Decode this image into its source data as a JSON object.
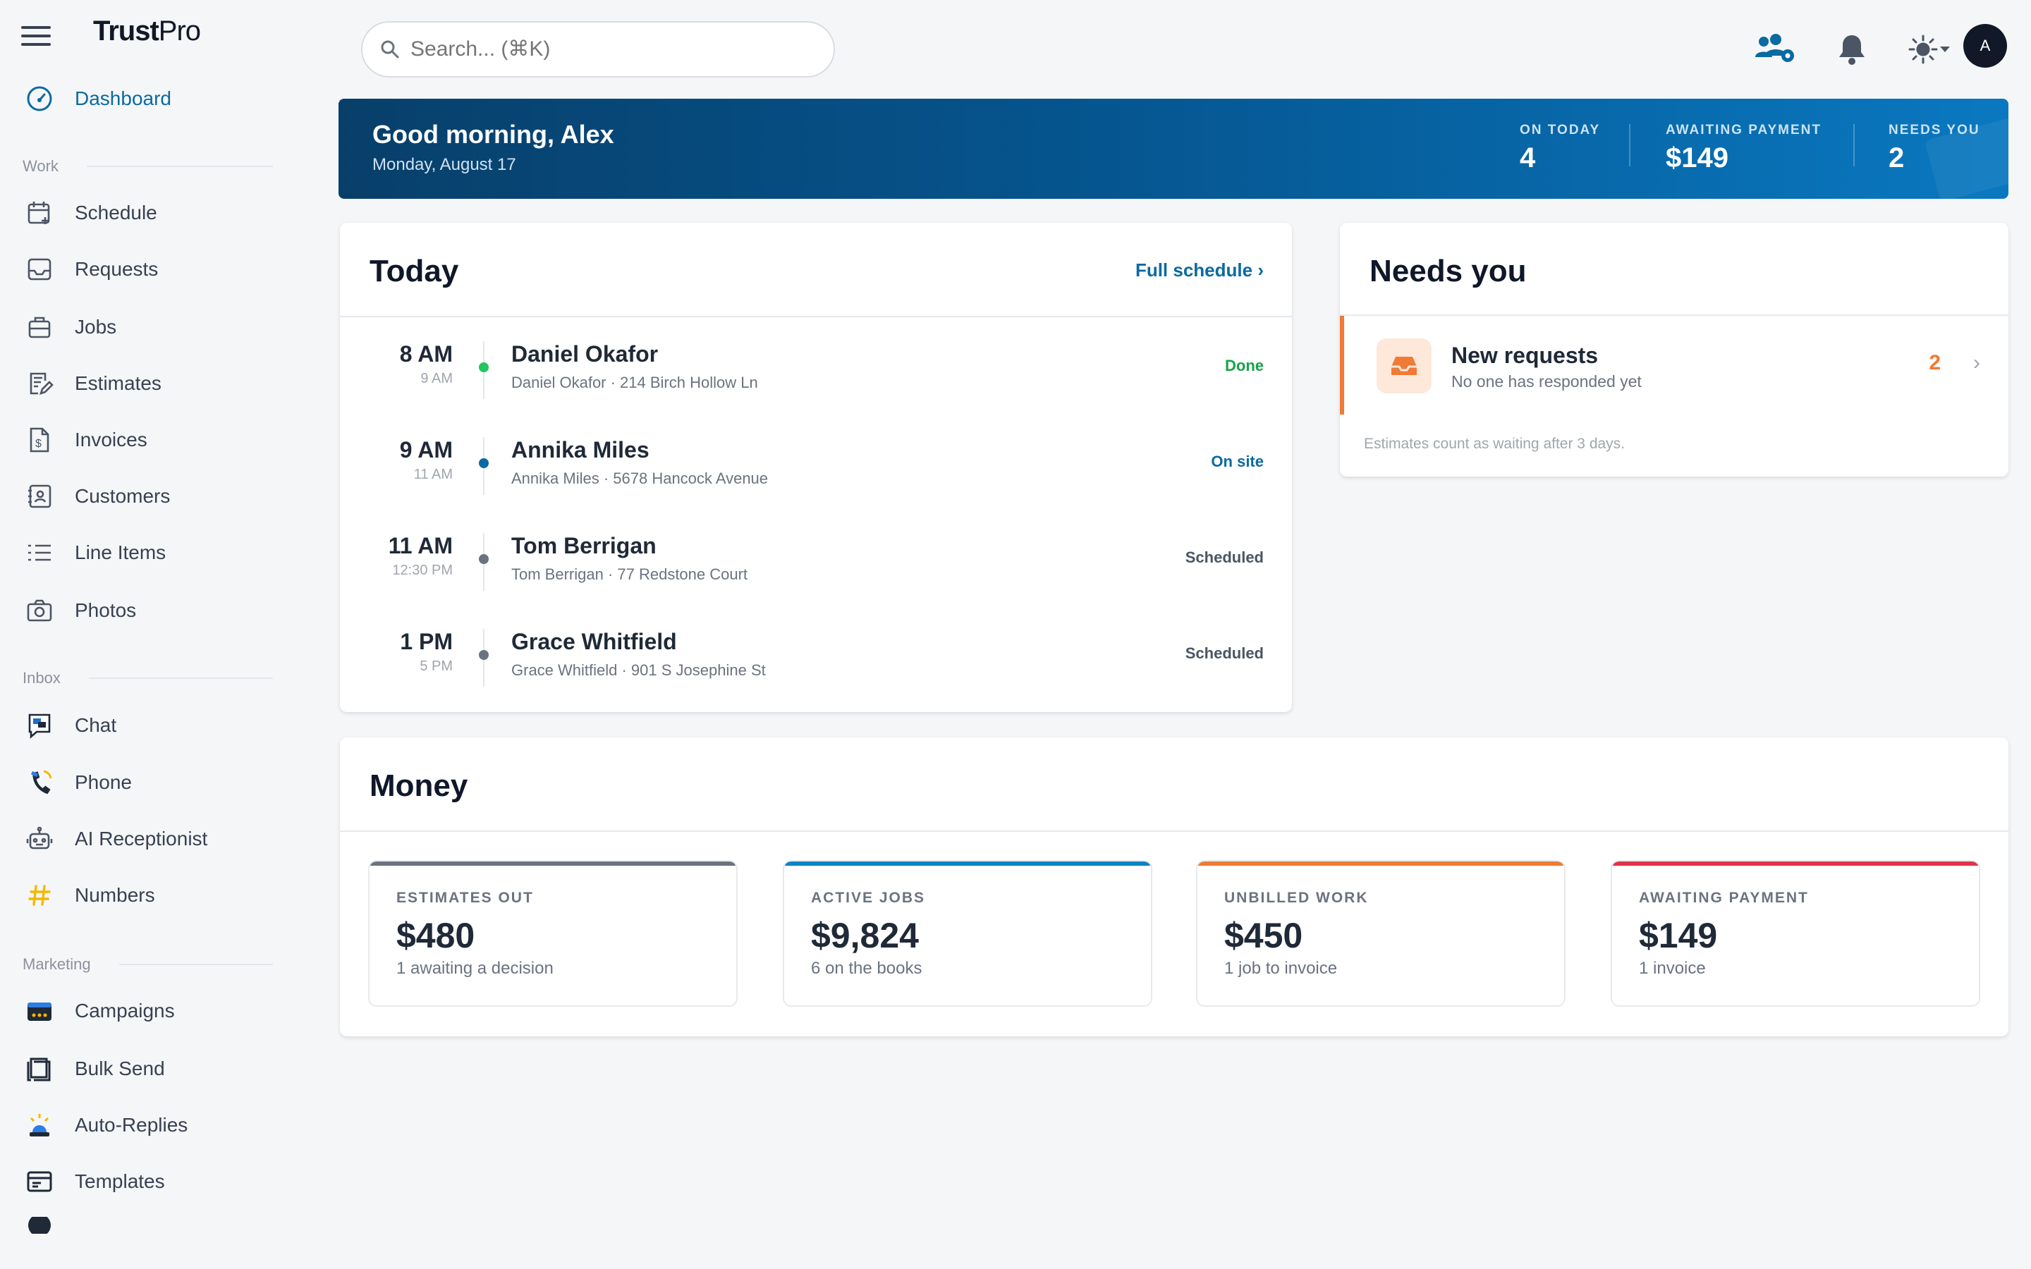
{
  "app": {
    "brand_main": "Trust",
    "brand_suffix": "Pro"
  },
  "sidebar": {
    "dashboard": "Dashboard",
    "sections": {
      "work": "Work",
      "inbox": "Inbox",
      "marketing": "Marketing"
    },
    "work_items": [
      "Schedule",
      "Requests",
      "Jobs",
      "Estimates",
      "Invoices",
      "Customers",
      "Line Items",
      "Photos"
    ],
    "inbox_items": [
      "Chat",
      "Phone",
      "AI Receptionist",
      "Numbers"
    ],
    "marketing_items": [
      "Campaigns",
      "Bulk Send",
      "Auto-Replies",
      "Templates"
    ]
  },
  "header": {
    "search_placeholder": "Search... (⌘K)",
    "avatar_initial": "A"
  },
  "banner": {
    "greeting": "Good morning, Alex",
    "date": "Monday, August 17",
    "stats": [
      {
        "label": "ON TODAY",
        "value": "4"
      },
      {
        "label": "AWAITING PAYMENT",
        "value": "$149"
      },
      {
        "label": "NEEDS YOU",
        "value": "2"
      }
    ]
  },
  "today": {
    "title": "Today",
    "link": "Full schedule",
    "rows": [
      {
        "time": "8 AM",
        "end": "9 AM",
        "name": "Daniel Okafor",
        "address": "Daniel Okafor · 214 Birch Hollow Ln",
        "status": "Done",
        "color": "#16a34a",
        "dot": "#22c55e"
      },
      {
        "time": "9 AM",
        "end": "11 AM",
        "name": "Annika Miles",
        "address": "Annika Miles · 5678 Hancock Avenue",
        "status": "On site",
        "color": "#0a6aa1",
        "dot": "#0a6aa1"
      },
      {
        "time": "11 AM",
        "end": "12:30 PM",
        "name": "Tom Berrigan",
        "address": "Tom Berrigan · 77 Redstone Court",
        "status": "Scheduled",
        "color": "#4b5563",
        "dot": "#6b7280"
      },
      {
        "time": "1 PM",
        "end": "5 PM",
        "name": "Grace Whitfield",
        "address": "Grace Whitfield · 901 S Josephine St",
        "status": "Scheduled",
        "color": "#4b5563",
        "dot": "#6b7280"
      }
    ]
  },
  "needs_you": {
    "title": "Needs you",
    "item_title": "New requests",
    "item_sub": "No one has responded yet",
    "count": "2",
    "note": "Estimates count as waiting after 3 days."
  },
  "money": {
    "title": "Money",
    "cards": [
      {
        "label": "ESTIMATES OUT",
        "value": "$480",
        "sub": "1 awaiting a decision",
        "color": "#6b7280"
      },
      {
        "label": "ACTIVE JOBS",
        "value": "$9,824",
        "sub": "6 on the books",
        "color": "#0a84c6"
      },
      {
        "label": "UNBILLED WORK",
        "value": "$450",
        "sub": "1 job to invoice",
        "color": "#ef7b34"
      },
      {
        "label": "AWAITING PAYMENT",
        "value": "$149",
        "sub": "1 invoice",
        "color": "#e0334a"
      }
    ]
  }
}
